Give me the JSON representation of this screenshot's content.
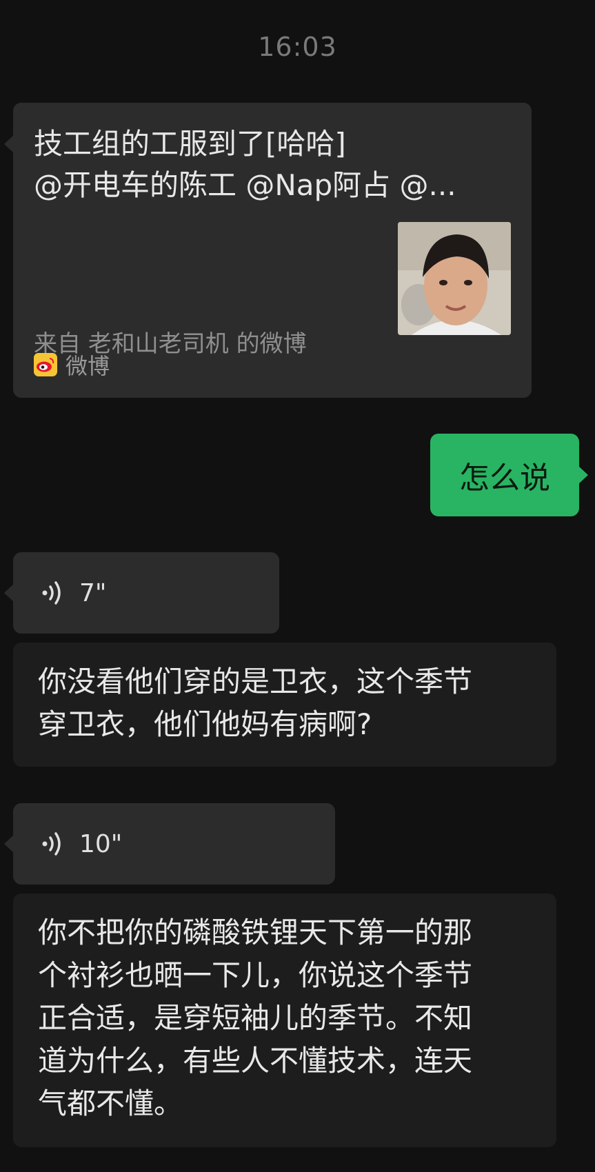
{
  "header": {
    "time": "16:03"
  },
  "link_card": {
    "title_lines": [
      "技工组的工服到了[哈哈]",
      "@开电车的陈工 @Nap阿占 @..."
    ],
    "description": "来自 老和山老司机 的微博",
    "source_label": "微博",
    "source_icon": "weibo-logo-icon",
    "thumbnail": "boy-portrait-photo"
  },
  "sent_message": {
    "text": "怎么说",
    "color": "#29b463"
  },
  "voice_messages": [
    {
      "duration": "7\"",
      "icon": "voice-wave-icon",
      "transcript_lines": [
        "你没看他们穿的是卫衣，这个季节",
        "穿卫衣，他们他妈有病啊?"
      ]
    },
    {
      "duration": "10\"",
      "icon": "voice-wave-icon",
      "transcript_lines": [
        "你不把你的磷酸铁锂天下第一的那",
        "个衬衫也晒一下儿，你说这个季节",
        "正合适，是穿短袖儿的季节。不知",
        "道为什么，有些人不懂技术，连天",
        "气都不懂。"
      ]
    }
  ]
}
